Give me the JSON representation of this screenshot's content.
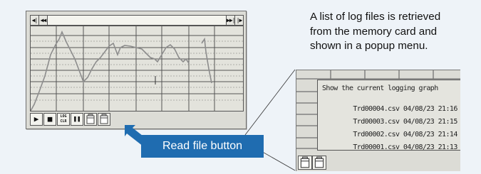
{
  "screen": {
    "top_toolbar": {
      "first_icon": "skip-to-start",
      "first_label": "◀|",
      "prev_icon": "fast-rewind",
      "prev_label": "◀◀",
      "next_icon": "fast-forward",
      "next_label": "▶▶|",
      "last_icon": "play-forward",
      "last_label": "|▶"
    },
    "bottom_toolbar": {
      "play_icon": "play",
      "play_label": "▶",
      "stop_icon": "stop",
      "stop_label": "■",
      "log_clear_label_top": "LOG",
      "log_clear_label_bottom": "CLR",
      "pause_icon": "pause",
      "pause_label": "❚❚",
      "save_file_icon": "memory-card-icon",
      "read_file_icon": "memory-card-icon"
    },
    "graph": {
      "line_color": "#8a8a8a",
      "grid_color": "#555555"
    }
  },
  "callout": {
    "label": "Read file button",
    "color": "#1f6cb0"
  },
  "description": {
    "line1": "A list of log files is retrieved",
    "line2": "from the memory card and",
    "line3": "shown in a popup menu."
  },
  "popup": {
    "header": "Show the current logging graph",
    "files": [
      {
        "name": "Trd00004.csv",
        "date": "04/08/23",
        "time": "21:16"
      },
      {
        "name": "Trd00003.csv",
        "date": "04/08/23",
        "time": "21:15"
      },
      {
        "name": "Trd00002.csv",
        "date": "04/08/23",
        "time": "21:14"
      },
      {
        "name": "Trd00001.csv",
        "date": "04/08/23",
        "time": "21:13"
      }
    ]
  }
}
